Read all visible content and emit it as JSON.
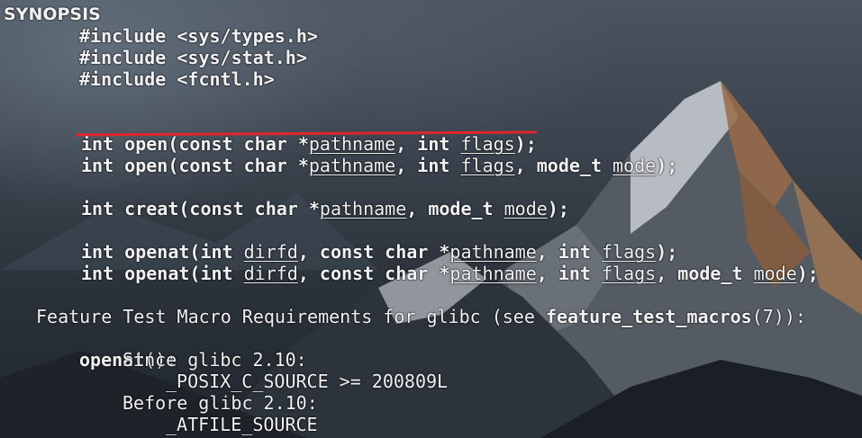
{
  "man_page": {
    "section_heading": "SYNOPSIS",
    "includes": [
      "#include <sys/types.h>",
      "#include <sys/stat.h>",
      "#include <fcntl.h>"
    ],
    "prototypes": [
      {
        "pre": "int open(const char *",
        "a1": "pathname",
        "m1": ", int ",
        "a2": "flags",
        "end": ");"
      },
      {
        "pre": "int open(const char *",
        "a1": "pathname",
        "m1": ", int ",
        "a2": "flags",
        "m2": ", mode_t ",
        "a3": "mode",
        "end": ");"
      },
      {
        "pre": "int creat(const char *",
        "a1": "pathname",
        "m1": ", mode_t ",
        "a2": "mode",
        "end": ");"
      },
      {
        "pre": "int openat(int ",
        "a1": "dirfd",
        "m1": ", const char *",
        "a2": "pathname",
        "m2": ", int ",
        "a3": "flags",
        "end": ");"
      },
      {
        "pre": "int openat(int ",
        "a1": "dirfd",
        "m1": ", const char *",
        "a2": "pathname",
        "m2": ", int ",
        "a3": "flags",
        "m3": ", mode_t ",
        "a4": "mode",
        "end": ");"
      }
    ],
    "feature_test": {
      "intro": "Feature Test Macro Requirements for glibc (see ",
      "ref": "feature_test_macros",
      "ref_tail": "(7)):"
    },
    "openat_req": {
      "func": "openat",
      "func_tail": "():",
      "since": "Since glibc 2.10:",
      "since_macro": "_POSIX_C_SOURCE >= 200809L",
      "before": "Before glibc 2.10:",
      "before_macro": "_ATFILE_SOURCE"
    }
  },
  "annotation": {
    "color": "#e0262b",
    "target": "int open(const char *pathname, int flags);"
  }
}
